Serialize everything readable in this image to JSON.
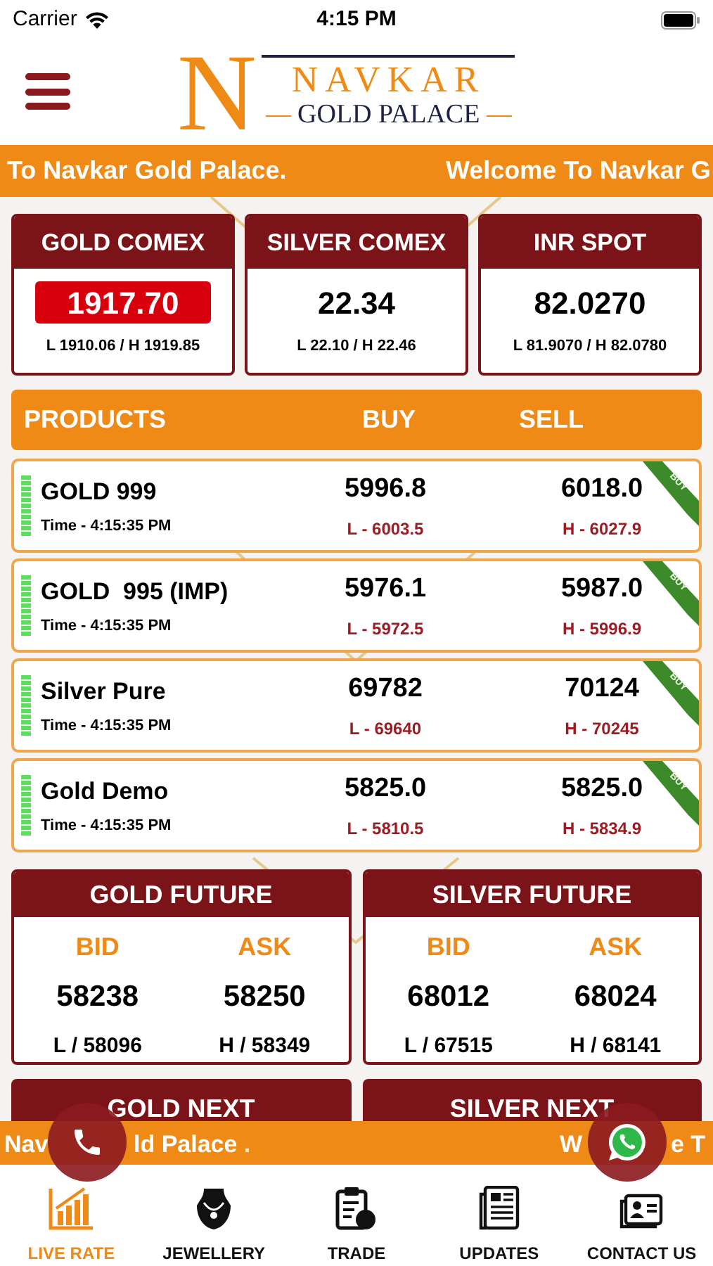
{
  "status_bar": {
    "carrier": "Carrier",
    "time": "4:15 PM"
  },
  "header": {
    "logo_letter": "N",
    "brand": "NAVKAR",
    "sub": "GOLD PALACE"
  },
  "top_ticker": [
    "To Navkar Gold Palace.",
    "Welcome To Navkar G"
  ],
  "spot_cards": [
    {
      "title": "GOLD COMEX",
      "value": "1917.70",
      "range": "L 1910.06 / H 1919.85",
      "highlighted": true
    },
    {
      "title": "SILVER COMEX",
      "value": "22.34",
      "range": "L 22.10 / H 22.46",
      "highlighted": false
    },
    {
      "title": "INR SPOT",
      "value": "82.0270",
      "range": "L 81.9070 / H 82.0780",
      "highlighted": false
    }
  ],
  "products_header": {
    "product": "PRODUCTS",
    "buy": "BUY",
    "sell": "SELL"
  },
  "products": [
    {
      "name": "GOLD 999",
      "time": "Time - 4:15:35 PM",
      "buy": "5996.8",
      "sell": "6018.0",
      "low": "L - 6003.5",
      "high": "H - 6027.9",
      "ribbon": "BUY"
    },
    {
      "name": "GOLD  995 (IMP)",
      "time": "Time - 4:15:35 PM",
      "buy": "5976.1",
      "sell": "5987.0",
      "low": "L - 5972.5",
      "high": "H - 5996.9",
      "ribbon": "BUY"
    },
    {
      "name": "Silver Pure",
      "time": "Time - 4:15:35 PM",
      "buy": "69782",
      "sell": "70124",
      "low": "L - 69640",
      "high": "H - 70245",
      "ribbon": "BUY"
    },
    {
      "name": "Gold Demo",
      "time": "Time - 4:15:35 PM",
      "buy": "5825.0",
      "sell": "5825.0",
      "low": "L - 5810.5",
      "high": "H - 5834.9",
      "ribbon": "BUY"
    }
  ],
  "futures": [
    {
      "title": "GOLD FUTURE",
      "bid_label": "BID",
      "ask_label": "ASK",
      "bid": "58238",
      "ask": "58250",
      "low": "L / 58096",
      "high": "H / 58349"
    },
    {
      "title": "SILVER FUTURE",
      "bid_label": "BID",
      "ask_label": "ASK",
      "bid": "68012",
      "ask": "68024",
      "low": "L / 67515",
      "high": "H / 68141"
    }
  ],
  "next_cards": [
    {
      "title": "GOLD NEXT"
    },
    {
      "title": "SILVER NEXT"
    }
  ],
  "bottom_ticker": [
    "Nav",
    "ld Palace .",
    "W",
    "e T"
  ],
  "tabs": [
    {
      "label": "LIVE RATE",
      "kind": "chart",
      "selected": true
    },
    {
      "label": "JEWELLERY",
      "kind": "necklace",
      "selected": false
    },
    {
      "label": "TRADE",
      "kind": "clipboard",
      "selected": false
    },
    {
      "label": "UPDATES",
      "kind": "newspaper",
      "selected": false
    },
    {
      "label": "CONTACT US",
      "kind": "contact",
      "selected": false
    }
  ]
}
